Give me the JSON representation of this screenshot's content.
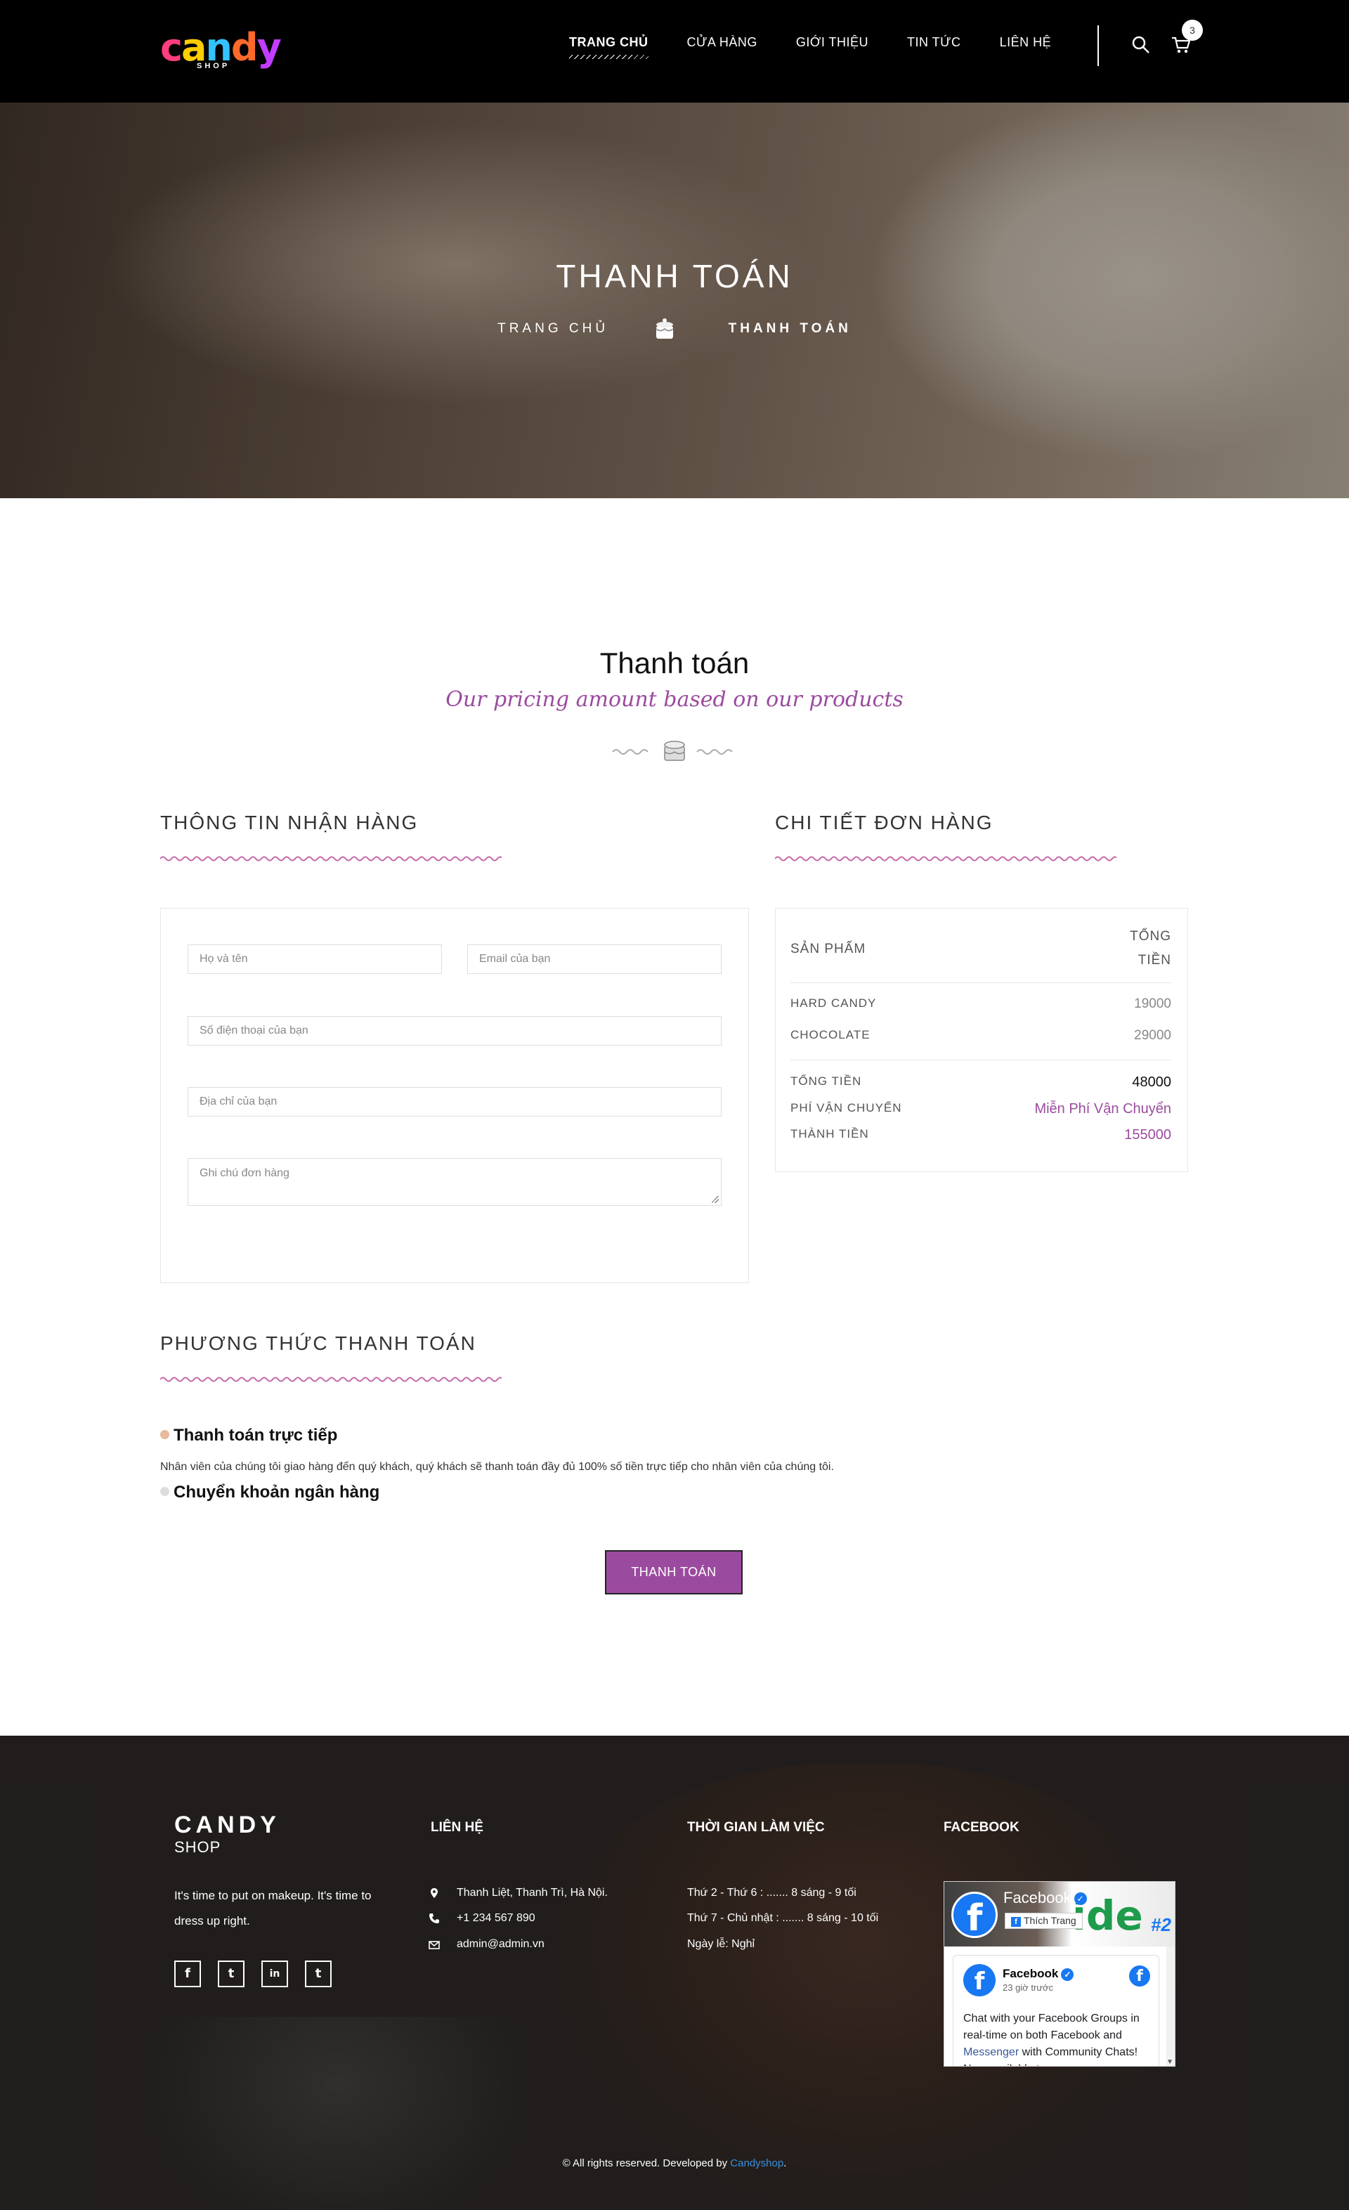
{
  "header": {
    "logo_text": "candy",
    "logo_sub": "SHOP",
    "nav": [
      {
        "label": "TRANG CHỦ",
        "active": true
      },
      {
        "label": "CỬA HÀNG",
        "active": false
      },
      {
        "label": "GIỚI THIỆU",
        "active": false
      },
      {
        "label": "TIN TỨC",
        "active": false
      },
      {
        "label": "LIÊN HỆ",
        "active": false
      }
    ],
    "search_icon": "search-icon",
    "cart_icon": "cart-icon",
    "cart_count": "3"
  },
  "hero": {
    "title": "THANH TOÁN",
    "crumb_home": "TRANG CHỦ",
    "crumb_current": "THANH TOÁN",
    "separator_icon": "cake-icon"
  },
  "section": {
    "title": "Thanh toán",
    "subtitle": "Our pricing amount based on our products"
  },
  "shipping": {
    "heading": "THÔNG TIN NHẬN HÀNG",
    "name_placeholder": "Họ và tên",
    "email_placeholder": "Email của bạn",
    "phone_placeholder": "Số điện thoại của bạn",
    "address_placeholder": "Địa chỉ của bạn",
    "note_placeholder": "Ghi chú đơn hàng"
  },
  "order": {
    "heading": "CHI TIẾT ĐƠN HÀNG",
    "col_product": "SẢN PHẨM",
    "col_total_line1": "TỔNG",
    "col_total_line2": "TIỀN",
    "items": [
      {
        "name": "HARD CANDY",
        "price": "19000"
      },
      {
        "name": "CHOCOLATE",
        "price": "29000"
      }
    ],
    "subtotal_label": "TỔNG TIỀN",
    "subtotal_value": "48000",
    "shipping_label": "PHÍ VẬN CHUYỂN",
    "shipping_value": "Miễn Phí Vận Chuyển",
    "total_label": "THÀNH TIỀN",
    "total_value": "155000"
  },
  "payment": {
    "heading": "PHƯƠNG THỨC THANH TOÁN",
    "option_cash": "Thanh toán trực tiếp",
    "option_cash_desc": "Nhân viên của chúng tôi giao hàng đến quý khách, quý khách sẽ thanh toán đầy đủ 100% số tiền trực tiếp cho nhân viên của chúng tôi.",
    "option_bank": "Chuyển khoản ngân hàng",
    "submit_label": "THANH TOÁN",
    "accent": "#9b4b9f"
  },
  "footer": {
    "brand": "CANDY",
    "brand_sub": "SHOP",
    "about": "It's time to put on makeup. It's time to dress up right.",
    "socials": [
      {
        "icon": "facebook-icon",
        "glyph": "f"
      },
      {
        "icon": "twitter-icon",
        "glyph": "t"
      },
      {
        "icon": "linkedin-icon",
        "glyph": "in"
      },
      {
        "icon": "tumblr-icon",
        "glyph": "t"
      }
    ],
    "contact_heading": "LIÊN HỆ",
    "address": "Thanh Liệt, Thanh Trì, Hà Nội.",
    "phone": "+1 234 567 890",
    "email": "admin@admin.vn",
    "hours_heading": "THỜI GIAN LÀM VIỆC",
    "hours_1": "Thứ 2 - Thứ 6 : ....... 8 sáng - 9 tối",
    "hours_2": "Thứ 7 - Chủ nhật : ....... 8 sáng - 10 tối",
    "hours_3": "Ngày lễ: Nghỉ",
    "facebook_heading": "FACEBOOK",
    "fb_page_name": "Facebook",
    "fb_like": "Thích Trang",
    "fb_cover_text": "ide",
    "fb_cover_num": "#2",
    "fb_post_name": "Facebook",
    "fb_post_time": "23 giờ trước",
    "fb_post_text_1": "Chat with your Facebook Groups in real-time on both Facebook and ",
    "fb_post_link": "Messenger",
    "fb_post_text_2": " with Community Chats! Now available to more",
    "copyright_text": "© All rights reserved. Developed by ",
    "copyright_link": "Candyshop",
    "copyright_end": "."
  }
}
